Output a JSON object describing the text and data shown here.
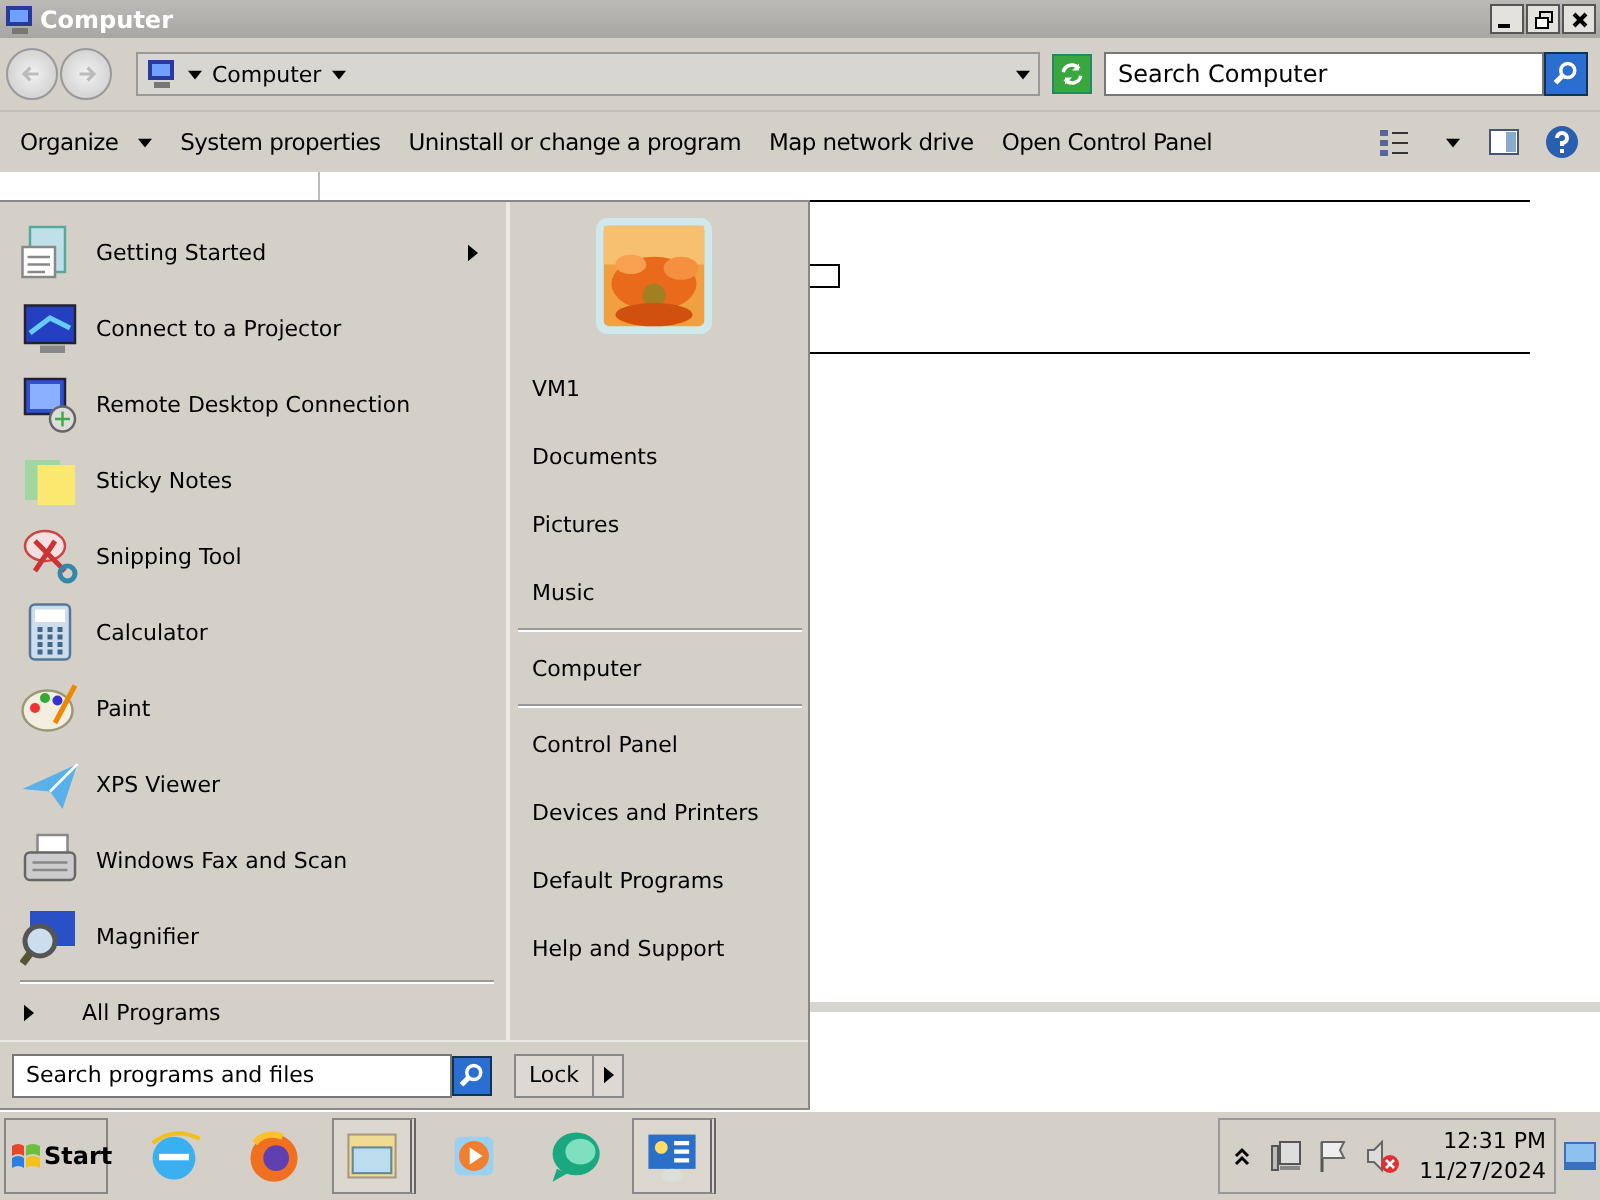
{
  "window": {
    "title": "Computer"
  },
  "address": {
    "location": "Computer",
    "search_placeholder": "Search Computer"
  },
  "commands": [
    {
      "label": "Organize",
      "menu": true
    },
    {
      "label": "System properties",
      "menu": false
    },
    {
      "label": "Uninstall or change a program",
      "menu": false
    },
    {
      "label": "Map network drive",
      "menu": false
    },
    {
      "label": "Open Control Panel",
      "menu": false
    }
  ],
  "start_menu": {
    "programs": [
      {
        "label": "Getting Started",
        "submenu": true
      },
      {
        "label": "Connect to a Projector",
        "submenu": false
      },
      {
        "label": "Remote Desktop Connection",
        "submenu": false
      },
      {
        "label": "Sticky Notes",
        "submenu": false
      },
      {
        "label": "Snipping Tool",
        "submenu": false
      },
      {
        "label": "Calculator",
        "submenu": false
      },
      {
        "label": "Paint",
        "submenu": false
      },
      {
        "label": "XPS Viewer",
        "submenu": false
      },
      {
        "label": "Windows Fax and Scan",
        "submenu": false
      },
      {
        "label": "Magnifier",
        "submenu": false
      }
    ],
    "all_programs": "All Programs",
    "search_placeholder": "Search programs and files",
    "place_groups": [
      {
        "items": [
          "VM1",
          "Documents",
          "Pictures",
          "Music"
        ]
      },
      {
        "items": [
          "Computer"
        ]
      },
      {
        "items": [
          "Control Panel",
          "Devices and Printers",
          "Default Programs",
          "Help and Support"
        ]
      }
    ],
    "lock": "Lock"
  },
  "taskbar": {
    "start": "Start",
    "apps": [
      {
        "open": false
      },
      {
        "open": false
      },
      {
        "open": true
      },
      {
        "open": false
      },
      {
        "open": false
      },
      {
        "open": true
      }
    ],
    "time": "12:31 PM",
    "date": "11/27/2024"
  }
}
